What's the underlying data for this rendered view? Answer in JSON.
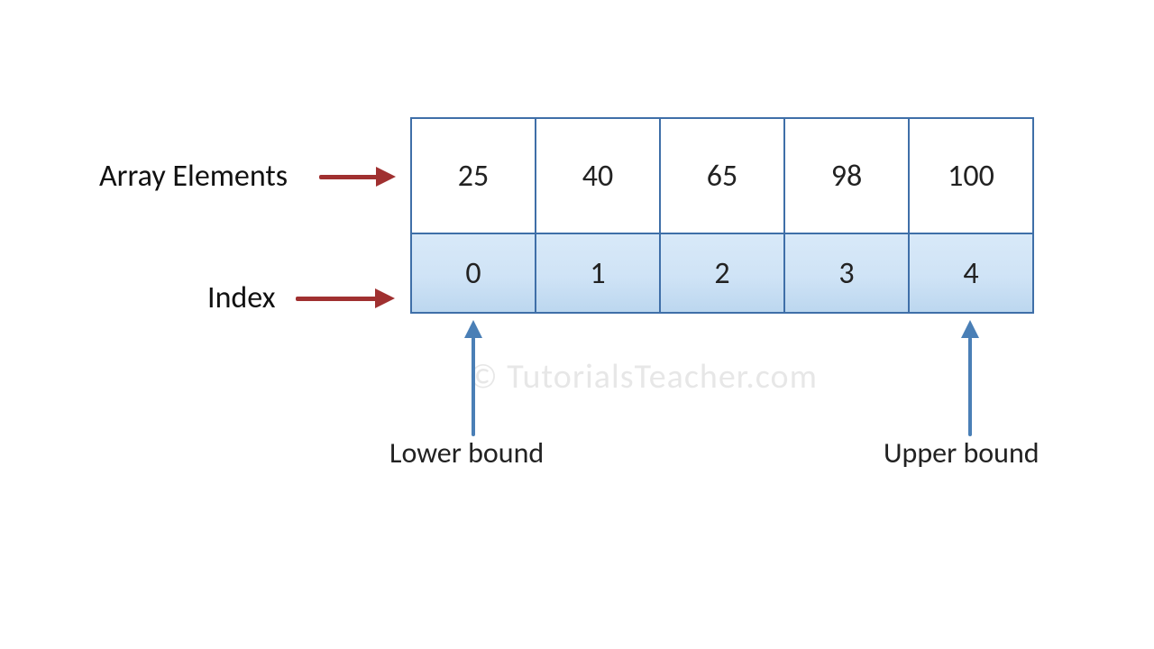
{
  "labels": {
    "elements": "Array Elements",
    "index": "Index",
    "lower_bound": "Lower bound",
    "upper_bound": "Upper bound"
  },
  "array": {
    "elements": [
      "25",
      "40",
      "65",
      "98",
      "100"
    ],
    "indices": [
      "0",
      "1",
      "2",
      "3",
      "4"
    ]
  },
  "watermark": "© TutorialsTeacher.com",
  "colors": {
    "cell_border": "#3f6fa8",
    "index_bg_top": "#d8e9f8",
    "index_bg_bottom": "#bcd7ef",
    "red_arrow": "#a03030",
    "blue_arrow": "#4a7fb6"
  }
}
